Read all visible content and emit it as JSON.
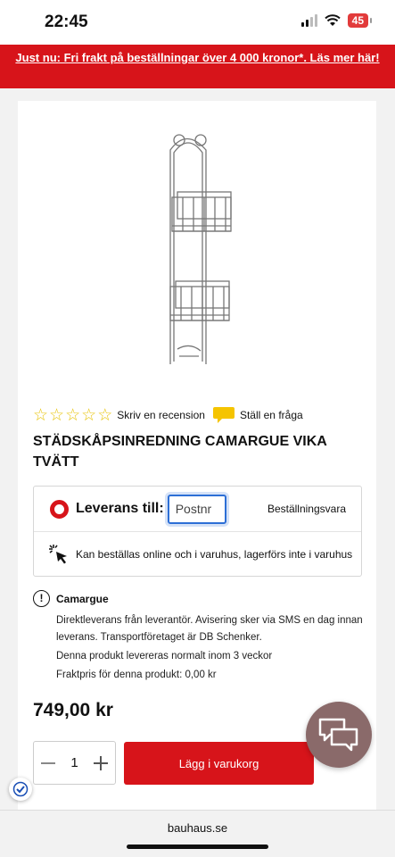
{
  "status_bar": {
    "time": "22:45",
    "battery": "45"
  },
  "promo": {
    "text": "Just nu: Fri frakt på beställningar över 4 000 kronor*. Läs mer här!"
  },
  "product": {
    "review_link": "Skriv en recension",
    "question_link": "Ställ en fråga",
    "title": "STÄDSKÅPSINREDNING CAMARGUE VIKA TVÄTT",
    "star_color": "#e8c50f"
  },
  "delivery": {
    "label": "Leverans till:",
    "postnr_placeholder": "Postnr",
    "order_type": "Beställningsvara",
    "availability": "Kan beställas online och i varuhus, lagerförs inte i varuhus"
  },
  "supplier": {
    "name": "Camargue",
    "lines": [
      "Direktleverans från leverantör. Avisering sker via SMS en dag innan leverans. Transportföretaget är DB Schenker.",
      "Denna produkt levereras normalt inom 3 veckor",
      "Fraktpris för denna produkt: 0,00 kr"
    ]
  },
  "price": "749,00 kr",
  "cart": {
    "quantity": "1",
    "button_label": "Lägg i varukorg"
  },
  "browser": {
    "url": "bauhaus.se"
  },
  "colors": {
    "brand_red": "#d7141a",
    "input_focus": "#2d6fd6",
    "chat_bubble": "#8a6a6a"
  }
}
